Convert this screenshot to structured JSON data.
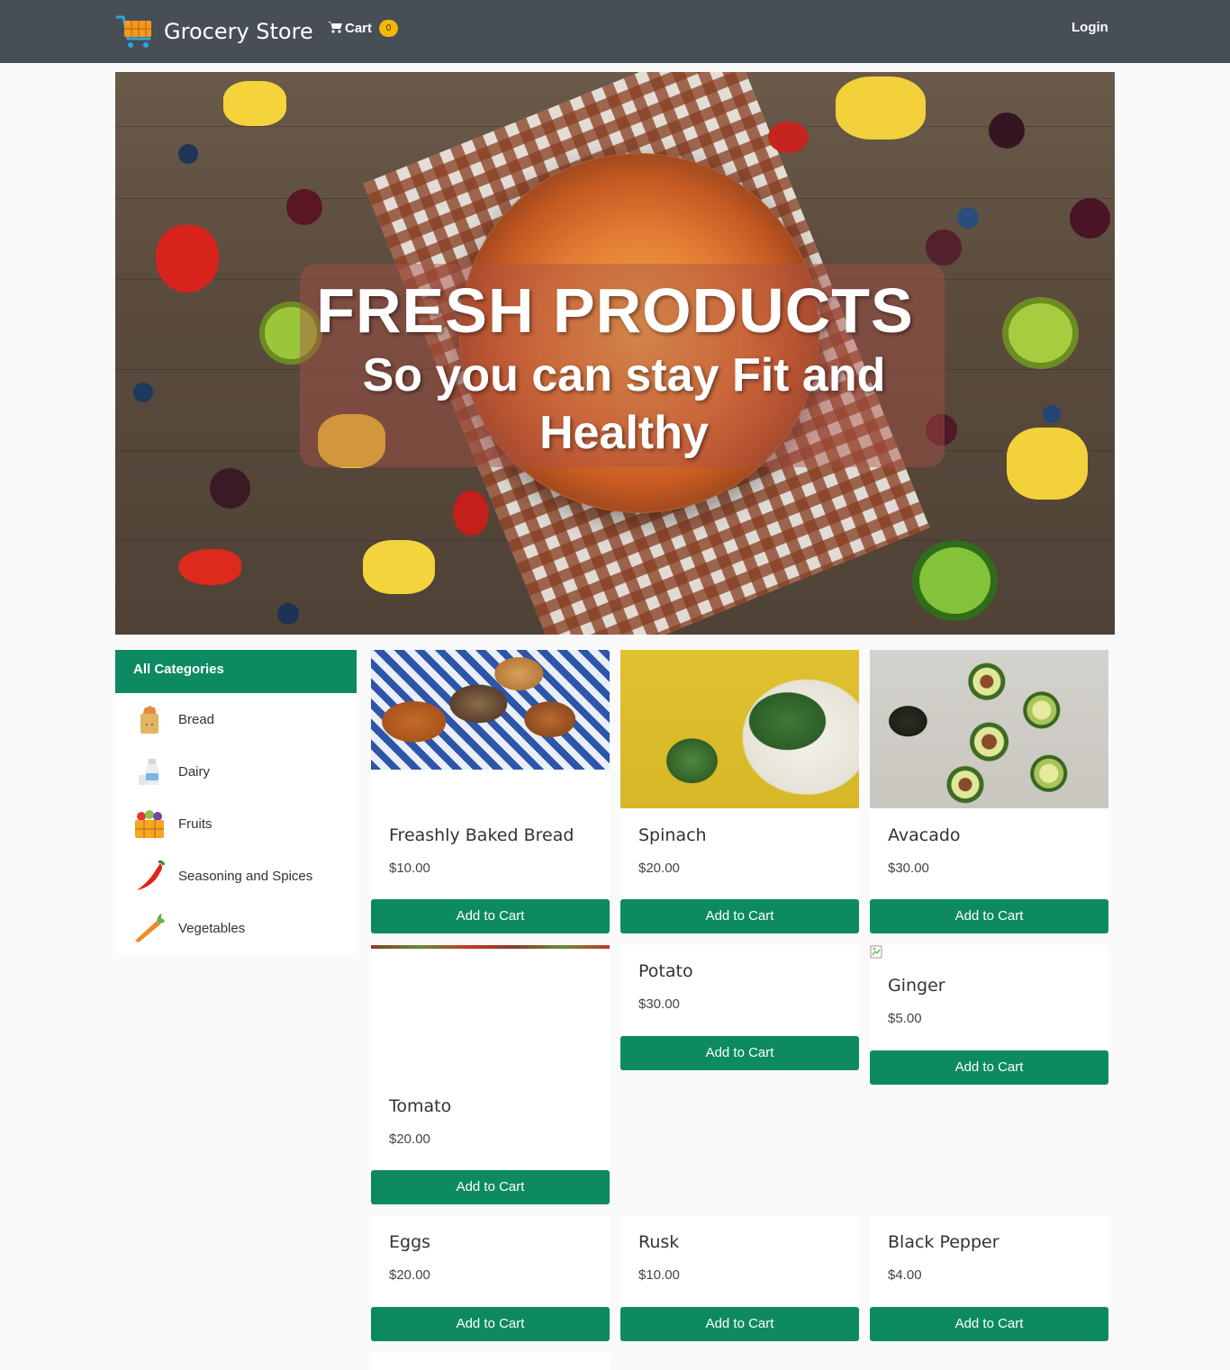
{
  "navbar": {
    "brand": "Grocery Store",
    "cart_label": "Cart",
    "cart_count": "0",
    "login_label": "Login"
  },
  "hero": {
    "title": "FRESH PRODUCTS",
    "subtitle": "So you can stay Fit and Healthy"
  },
  "sidebar": {
    "heading": "All Categories",
    "items": [
      {
        "label": "Bread",
        "icon": "bread-bag-icon"
      },
      {
        "label": "Dairy",
        "icon": "milk-bottle-icon"
      },
      {
        "label": "Fruits",
        "icon": "fruit-basket-icon"
      },
      {
        "label": "Seasoning and Spices",
        "icon": "chili-pepper-icon"
      },
      {
        "label": "Vegetables",
        "icon": "carrot-icon"
      }
    ]
  },
  "products": [
    {
      "name": "Freashly Baked Bread",
      "price": "$10.00",
      "button": "Add to Cart"
    },
    {
      "name": "Spinach",
      "price": "$20.00",
      "button": "Add to Cart"
    },
    {
      "name": "Avacado",
      "price": "$30.00",
      "button": "Add to Cart"
    },
    {
      "name": "Tomato",
      "price": "$20.00",
      "button": "Add to Cart"
    },
    {
      "name": "Potato",
      "price": "$30.00",
      "button": "Add to Cart"
    },
    {
      "name": "Ginger",
      "price": "$5.00",
      "button": "Add to Cart"
    },
    {
      "name": "Eggs",
      "price": "$20.00",
      "button": "Add to Cart"
    },
    {
      "name": "Rusk",
      "price": "$10.00",
      "button": "Add to Cart"
    },
    {
      "name": "Black Pepper",
      "price": "$4.00",
      "button": "Add to Cart"
    }
  ],
  "colors": {
    "navbar": "#474e56",
    "accent": "#0d8a62",
    "badge": "#f5b800"
  }
}
